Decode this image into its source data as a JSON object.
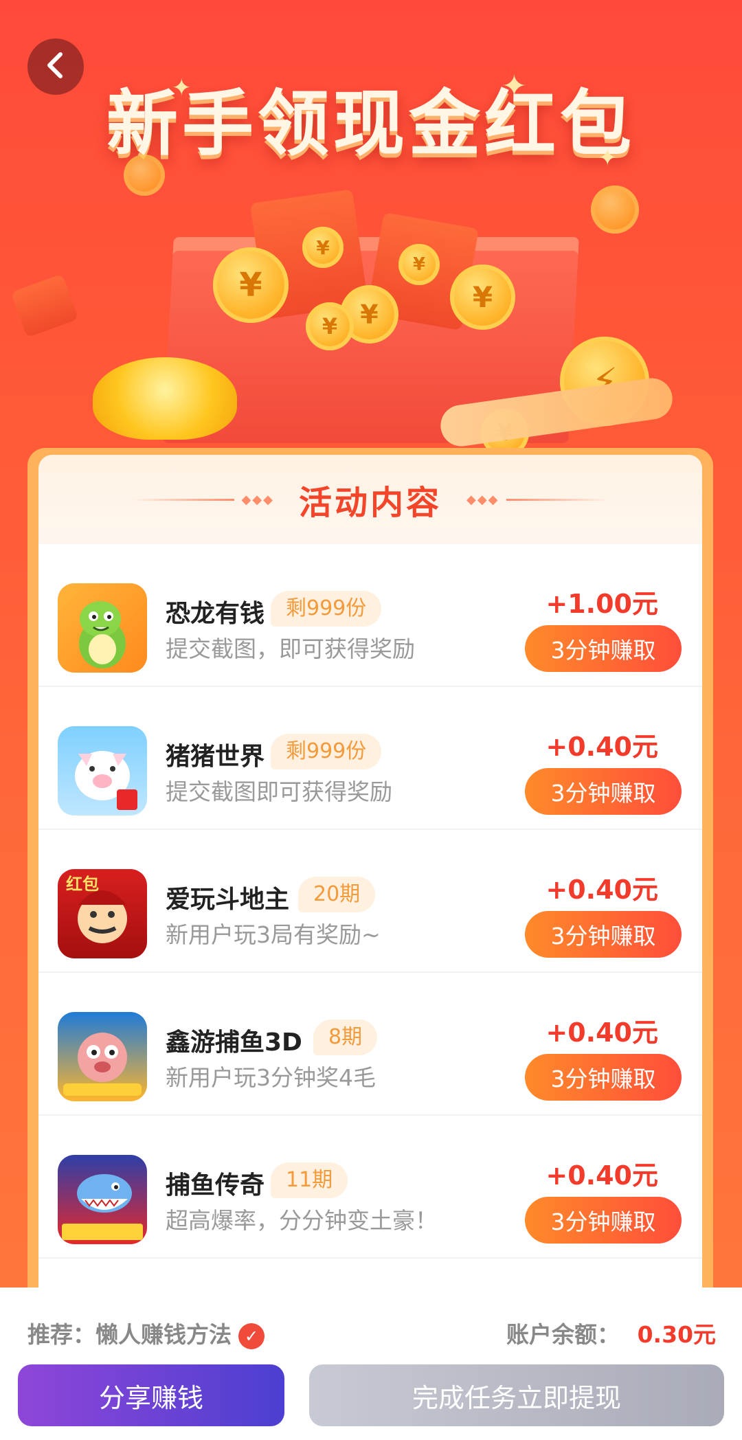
{
  "header": {
    "title": "新手领现金红包",
    "back_icon": "chevron-left-icon"
  },
  "card": {
    "title": "活动内容"
  },
  "tasks": [
    {
      "name": "恐龙有钱",
      "badge": "剩999份",
      "desc": "提交截图，即可获得奖励",
      "reward": "+1.00元",
      "button": "3分钟赚取",
      "icon": "dinosaur-app-icon"
    },
    {
      "name": "猪猪世界",
      "badge": "剩999份",
      "desc": "提交截图即可获得奖励",
      "reward": "+0.40元",
      "button": "3分钟赚取",
      "icon": "pig-app-icon"
    },
    {
      "name": "爱玩斗地主",
      "badge": "20期",
      "desc": "新用户玩3局有奖励~",
      "reward": "+0.40元",
      "button": "3分钟赚取",
      "icon": "landlord-app-icon"
    },
    {
      "name": "鑫游捕鱼3D",
      "badge": "8期",
      "desc": "新用户玩3分钟奖4毛",
      "reward": "+0.40元",
      "button": "3分钟赚取",
      "icon": "fish-app-icon"
    },
    {
      "name": "捕鱼传奇",
      "badge": "11期",
      "desc": "超高爆率，分分钟变土豪！",
      "reward": "+0.40元",
      "button": "3分钟赚取",
      "icon": "shark-app-icon"
    }
  ],
  "bottom": {
    "recommend": "推荐：懒人赚钱方法",
    "balance_label": "账户余额：",
    "balance_value": "0.30元",
    "share_label": "分享赚钱",
    "withdraw_label": "完成任务立即提现"
  },
  "colors": {
    "accent": "#f23b2a",
    "primary_button": "#4c3fd1",
    "disabled_button": "#a9acb8"
  }
}
